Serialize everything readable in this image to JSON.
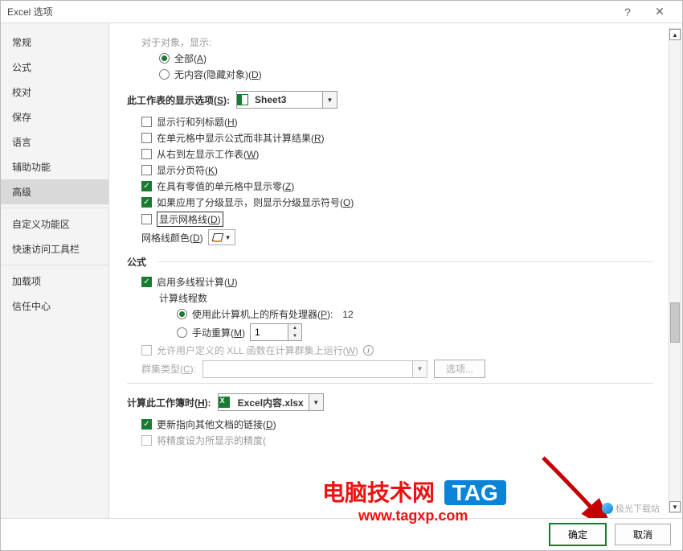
{
  "title": "Excel 选项",
  "sidebar": {
    "items": [
      {
        "label": "常规"
      },
      {
        "label": "公式"
      },
      {
        "label": "校对"
      },
      {
        "label": "保存"
      },
      {
        "label": "语言"
      },
      {
        "label": "辅助功能"
      },
      {
        "label": "高级"
      },
      {
        "label": "自定义功能区"
      },
      {
        "label": "快速访问工具栏"
      },
      {
        "label": "加载项"
      },
      {
        "label": "信任中心"
      }
    ]
  },
  "top_group": {
    "title_partial": "对于对象，显示:",
    "radio_all": "全部(",
    "radio_all_m": "A",
    "radio_none": "无内容(隐藏对象)(",
    "radio_none_m": "D"
  },
  "section_sheet": {
    "title": "此工作表的显示选项(",
    "title_m": "S",
    "title_close": "):",
    "combo_value": "Sheet3",
    "cb_headers": "显示行和列标题(",
    "cb_headers_m": "H",
    "cb_formulas": "在单元格中显示公式而非其计算结果(",
    "cb_formulas_m": "R",
    "cb_rtl": "从右到左显示工作表(",
    "cb_rtl_m": "W",
    "cb_pagebreaks": "显示分页符(",
    "cb_pagebreaks_m": "K",
    "cb_zeros": "在具有零值的单元格中显示零(",
    "cb_zeros_m": "Z",
    "cb_outline": "如果应用了分级显示，则显示分级显示符号(",
    "cb_outline_m": "O",
    "cb_grid": "显示网格线(",
    "cb_grid_m": "D",
    "grid_color_label": "网格线颜色(",
    "grid_color_m": "D"
  },
  "section_formulas": {
    "title": "公式",
    "cb_multithread": "启用多线程计算(",
    "cb_multithread_m": "U",
    "threads_label": "计算线程数",
    "radio_allproc": "使用此计算机上的所有处理器(",
    "radio_allproc_m": "P",
    "radio_allproc_close": "):",
    "proc_count": "12",
    "radio_manual": "手动重算(",
    "radio_manual_m": "M",
    "manual_spin_value": "1",
    "cb_xll": "允许用户定义的 XLL 函数在计算群集上运行(",
    "cb_xll_m": "W",
    "cluster_label": "群集类型(",
    "cluster_m": "C",
    "cluster_close": "):",
    "options_btn": "选项..."
  },
  "section_workbook": {
    "title": "计算此工作簿时(",
    "title_m": "H",
    "title_close": "):",
    "combo_value": "Excel内容.xlsx",
    "cb_update_links": "更新指向其他文档的链接(",
    "cb_update_links_m": "D",
    "cb_precision_partial": "将精度设为所显示的精度("
  },
  "footer": {
    "ok": "确定",
    "cancel": "取消"
  },
  "watermark": {
    "t1": "电脑技术网",
    "tag": "TAG",
    "url": "www.tagxp.com"
  },
  "jg": "极光下载站"
}
